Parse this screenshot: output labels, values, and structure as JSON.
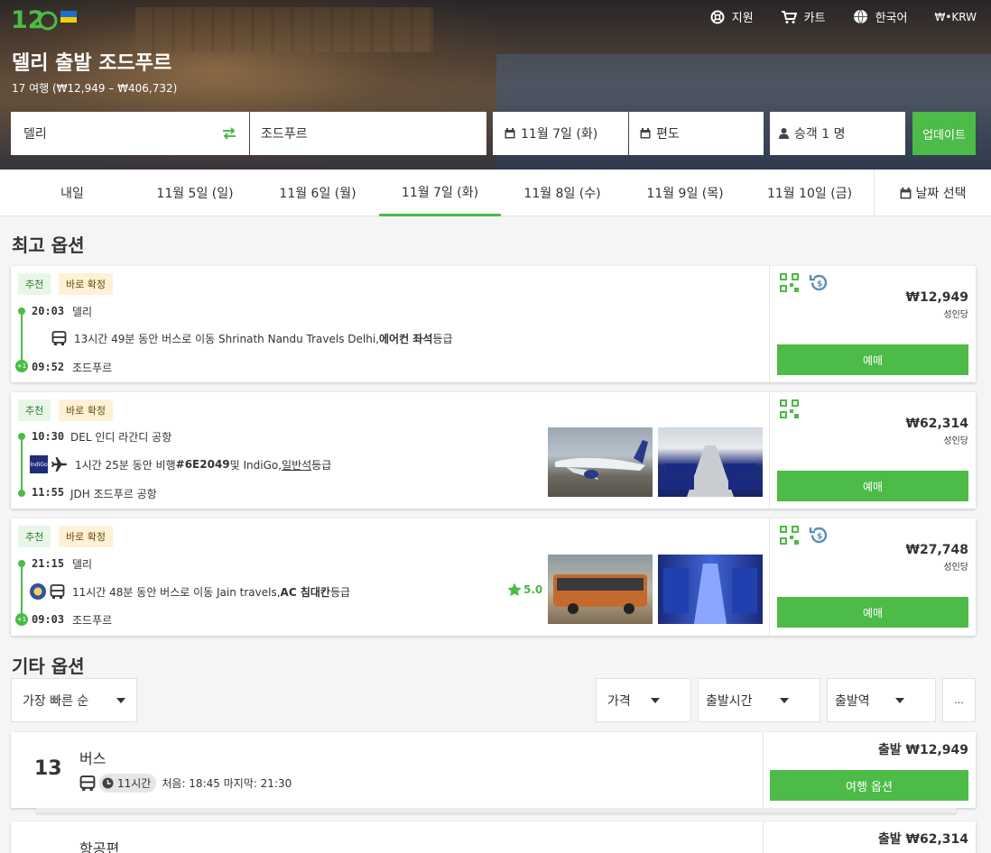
{
  "header": {
    "logo": "12Go",
    "nav": {
      "support": "지원",
      "cart": "카트",
      "language": "한국어",
      "currency": "₩•KRW"
    },
    "title": "델리 출발 조드푸르",
    "subtitle": "17 여행 (₩12,949 – ₩406,732)"
  },
  "search": {
    "from": "델리",
    "to": "조드푸르",
    "date": "11월 7일 (화)",
    "return": "편도",
    "passengers": "승객 1 명",
    "update": "업데이트"
  },
  "dates": [
    "내일",
    "11월 5일 (일)",
    "11월 6일 (월)",
    "11월 7일 (화)",
    "11월 8일 (수)",
    "11월 9일 (목)",
    "11월 10일 (금)"
  ],
  "date_pick": "날짜 선택",
  "best_title": "최고 옵션",
  "tags": {
    "recommended": "추천",
    "instant": "바로 확정"
  },
  "cards": [
    {
      "dep_time": "20:03",
      "dep_place": "델리",
      "desc_pre": "13시간 49분 동안 버스로 이동 Shrinath Nandu Travels Delhi, ",
      "desc_bold": "에어컨 좌석",
      "desc_post": " 등급",
      "arr_time": "09:52",
      "arr_place": "조드푸르",
      "plus": "+1",
      "price": "₩12,949",
      "per": "성인당",
      "book": "예매"
    },
    {
      "dep_time": "10:30",
      "dep_place": "DEL 인디 라간디 공항",
      "desc_pre": "1시간 25분 동안 비행 ",
      "desc_bold": "#6E2049",
      "desc_post": " 및 IndiGo, ",
      "desc_under": "일반석",
      "desc_end": "등급",
      "arr_time": "11:55",
      "arr_place": "JDH 조드푸르 공항",
      "price": "₩62,314",
      "per": "성인당",
      "book": "예매",
      "airline": "IndiGo"
    },
    {
      "dep_time": "21:15",
      "dep_place": "델리",
      "desc_pre": "11시간 48분 동안 버스로 이동 Jain travels, ",
      "desc_bold": "AC 침대칸",
      "desc_post": " 등급",
      "arr_time": "09:03",
      "arr_place": "조드푸르",
      "plus": "+1",
      "rating": "5.0",
      "price": "₩27,748",
      "per": "성인당",
      "book": "예매"
    }
  ],
  "other_title": "기타 옵션",
  "filters": {
    "sort": "가장 빠른 순",
    "price": "가격",
    "departure_time": "출발시간",
    "station": "출발역",
    "more": "..."
  },
  "groups": [
    {
      "count": "13",
      "name": "버스",
      "duration": "11시간",
      "times": "처음: 18:45 마지막: 21:30",
      "price": "출발 ₩12,949",
      "button": "여행 옵션"
    },
    {
      "name": "항공편",
      "price": "출발 ₩62,314"
    }
  ],
  "colors": {
    "accent": "#4cbb47"
  }
}
